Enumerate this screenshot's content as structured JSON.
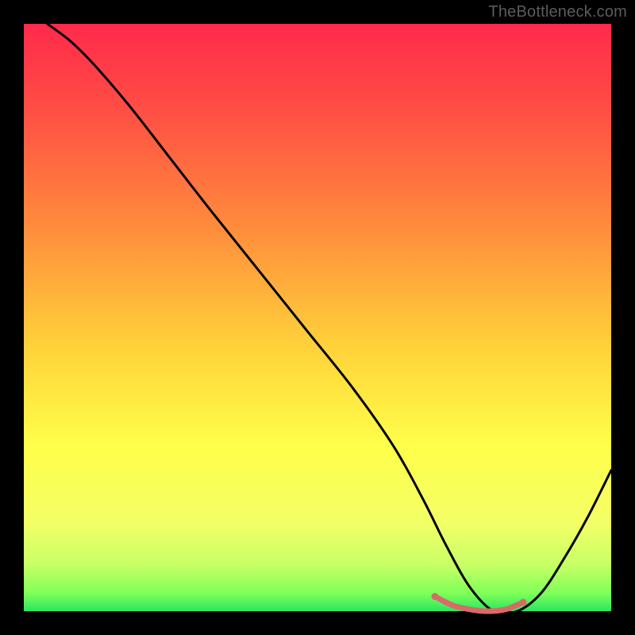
{
  "watermark": "TheBottleneck.com",
  "chart_data": {
    "type": "line",
    "title": "",
    "xlabel": "",
    "ylabel": "",
    "xlim": [
      0,
      100
    ],
    "ylim": [
      0,
      100
    ],
    "grid": false,
    "legend": false,
    "description": "Bottleneck curve over a red-to-green vertical gradient; black line shows mismatch magnitude dropping to a minimum near x≈78 then rising. Small coral segment marks the flat minimum region.",
    "gradient_stops": [
      {
        "offset": 0.0,
        "color": "#ff2a4b"
      },
      {
        "offset": 0.15,
        "color": "#ff4f44"
      },
      {
        "offset": 0.35,
        "color": "#ff8d3c"
      },
      {
        "offset": 0.55,
        "color": "#ffd23a"
      },
      {
        "offset": 0.72,
        "color": "#ffff4a"
      },
      {
        "offset": 0.85,
        "color": "#f3ff66"
      },
      {
        "offset": 0.92,
        "color": "#c8ff66"
      },
      {
        "offset": 0.97,
        "color": "#7fff58"
      },
      {
        "offset": 1.0,
        "color": "#28e661"
      }
    ],
    "series": [
      {
        "name": "bottleneck-curve",
        "color": "#000000",
        "x": [
          4,
          8,
          12,
          18,
          25,
          32,
          40,
          48,
          56,
          63,
          68,
          72,
          76,
          80,
          84,
          88,
          92,
          96,
          100
        ],
        "y": [
          100,
          97,
          93,
          86,
          77,
          68,
          58,
          48,
          38,
          28,
          19,
          11,
          4,
          0,
          0,
          3,
          9,
          16,
          24
        ]
      },
      {
        "name": "optimal-band",
        "color": "#d86a68",
        "x": [
          70,
          73,
          76,
          79,
          82,
          85
        ],
        "y": [
          2.5,
          1.0,
          0.3,
          0.0,
          0.3,
          1.5
        ]
      }
    ]
  }
}
